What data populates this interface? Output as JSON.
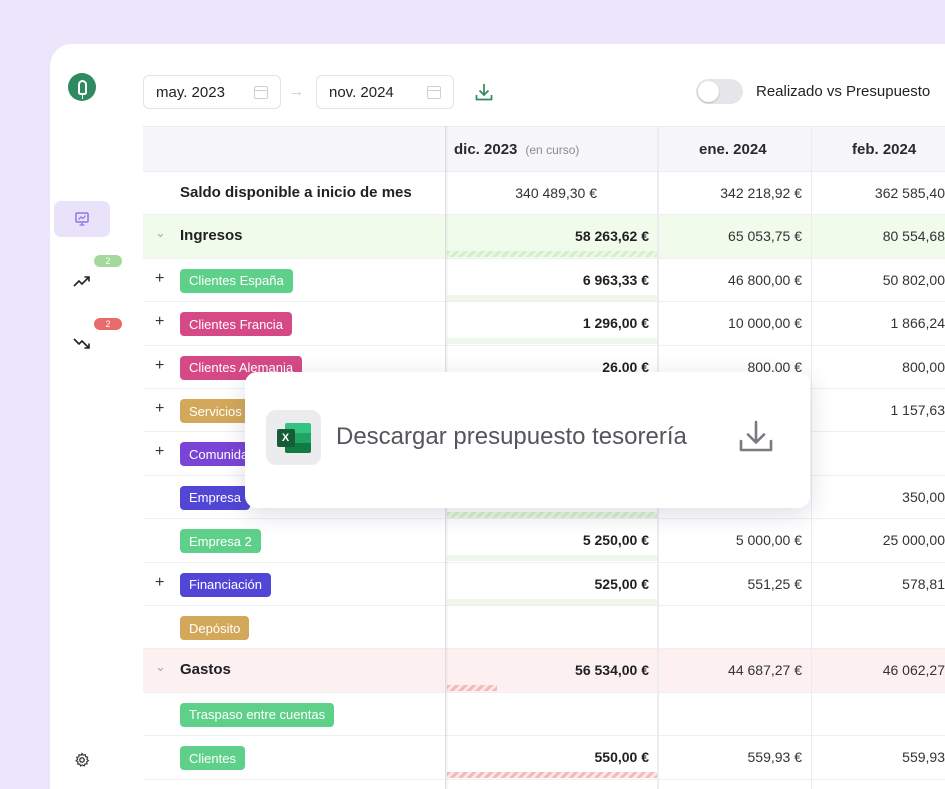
{
  "toolbar": {
    "start_date": "may. 2023",
    "end_date": "nov. 2024",
    "arrow": "→",
    "toggle_label": "Realizado vs Presupuesto"
  },
  "sidebar": {
    "badge_income": "2",
    "badge_expense": "2",
    "badge_income_color": "#a3d99a",
    "badge_expense_color": "#e86a6a"
  },
  "header": {
    "col1": "dic. 2023",
    "col1_sub": "(en curso)",
    "col2": "ene. 2024",
    "col3": "feb. 2024"
  },
  "rows": [
    {
      "label": "Saldo disponible a inicio de mes",
      "v1": "340 489,30 €",
      "v2": "342 218,92 €",
      "v3": "362 585,40"
    },
    {
      "label": "Ingresos",
      "v1": "58 263,62 €",
      "v2": "65 053,75 €",
      "v3": "80 554,68"
    },
    {
      "label": "Clientes España",
      "v1": "6 963,33 €",
      "v2": "46 800,00 €",
      "v3": "50 802,00"
    },
    {
      "label": "Clientes Francia",
      "v1": "1 296,00 €",
      "v2": "10 000,00 €",
      "v3": "1 866,24"
    },
    {
      "label": "Clientes Alemania",
      "v1": "26,00 €",
      "v2": "800,00 €",
      "v3": "800,00"
    },
    {
      "label": "Servicios",
      "v1": "",
      "v2": "",
      "v3": "1 157,63"
    },
    {
      "label": "Comunidad",
      "v1": "",
      "v2": "",
      "v3": ""
    },
    {
      "label": "Empresa",
      "v1": "",
      "v2": "",
      "v3": "350,00"
    },
    {
      "label": "Empresa 2",
      "v1": "5 250,00 €",
      "v2": "5 000,00 €",
      "v3": "25 000,00"
    },
    {
      "label": "Financiación",
      "v1": "525,00 €",
      "v2": "551,25 €",
      "v3": "578,81"
    },
    {
      "label": "Depósito",
      "v1": "",
      "v2": "",
      "v3": ""
    },
    {
      "label": "Gastos",
      "v1": "56 534,00 €",
      "v2": "44 687,27 €",
      "v3": "46 062,27"
    },
    {
      "label": "Traspaso entre cuentas",
      "v1": "",
      "v2": "",
      "v3": ""
    },
    {
      "label": "Clientes",
      "v1": "550,00 €",
      "v2": "559,93 €",
      "v3": "559,93"
    }
  ],
  "tag_colors": {
    "green": "#5fd08a",
    "pink": "#d54a86",
    "gold": "#d4a85a",
    "purple": "#7a45d6",
    "indigo": "#5146d6"
  },
  "popup": {
    "text": "Descargar presupuesto tesorería",
    "excel_letter": "X"
  }
}
